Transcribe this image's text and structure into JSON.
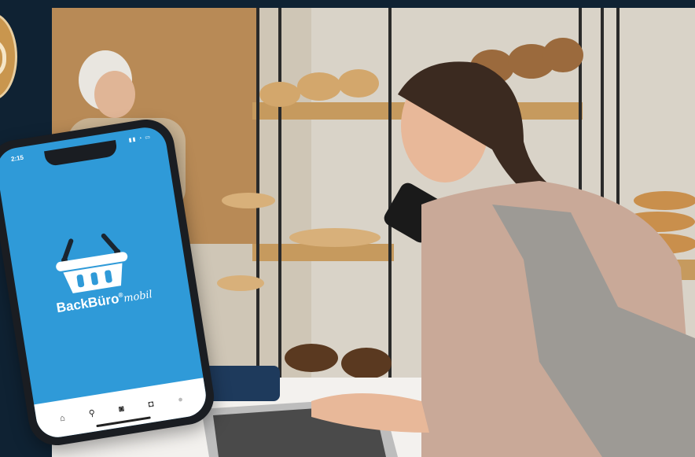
{
  "scene": {
    "description_colors": {
      "frame_bg": "#0f2233",
      "app_blue": "#2f9ad8",
      "badge_gold": "#c9964e"
    }
  },
  "phone": {
    "status_time": "2:15",
    "status_icons": "▮▮ ◔ ▭",
    "brand_name": "BackBüro",
    "brand_reg": "®",
    "brand_suffix": "mobil",
    "logo_icon": "basket-icon",
    "tabs": [
      {
        "icon": "home-icon",
        "glyph": "⌂"
      },
      {
        "icon": "search-icon",
        "glyph": "⚲"
      },
      {
        "icon": "camera-icon",
        "glyph": "◙"
      },
      {
        "icon": "bag-icon",
        "glyph": "◘"
      },
      {
        "icon": "profile-icon",
        "glyph": "●"
      }
    ]
  }
}
